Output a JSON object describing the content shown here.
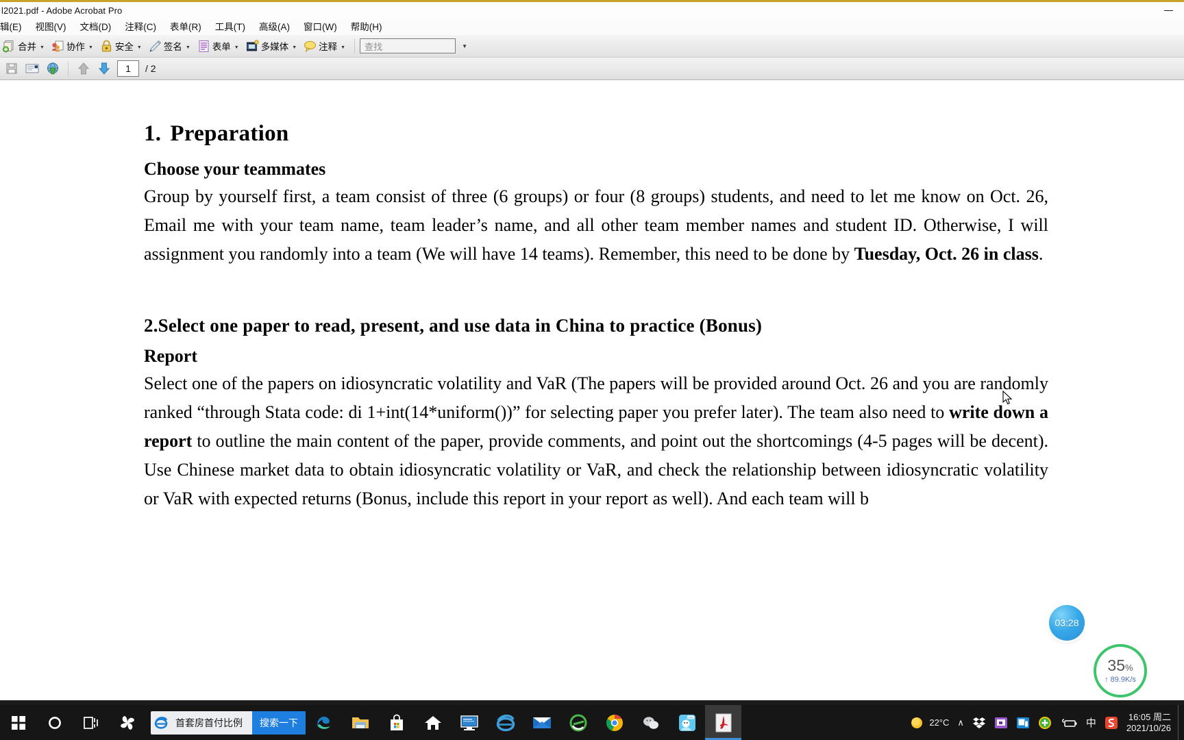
{
  "window": {
    "title": "l2021.pdf - Adobe Acrobat Pro",
    "minimize_label": "—"
  },
  "menubar": {
    "items": [
      {
        "label": "辑(E)",
        "name": "menu-edit"
      },
      {
        "label": "视图(V)",
        "name": "menu-view"
      },
      {
        "label": "文档(D)",
        "name": "menu-document"
      },
      {
        "label": "注释(C)",
        "name": "menu-comments"
      },
      {
        "label": "表单(R)",
        "name": "menu-forms"
      },
      {
        "label": "工具(T)",
        "name": "menu-tools"
      },
      {
        "label": "高级(A)",
        "name": "menu-advanced"
      },
      {
        "label": "窗口(W)",
        "name": "menu-window"
      },
      {
        "label": "帮助(H)",
        "name": "menu-help"
      }
    ]
  },
  "toolbar": {
    "buttons": [
      {
        "label": "合并",
        "icon": "merge-icon",
        "name": "toolbar-merge"
      },
      {
        "label": "协作",
        "icon": "collaborate-icon",
        "name": "toolbar-collaborate"
      },
      {
        "label": "安全",
        "icon": "lock-icon",
        "name": "toolbar-security"
      },
      {
        "label": "签名",
        "icon": "pen-icon",
        "name": "toolbar-sign"
      },
      {
        "label": "表单",
        "icon": "form-icon",
        "name": "toolbar-forms"
      },
      {
        "label": "多媒体",
        "icon": "multimedia-icon",
        "name": "toolbar-multimedia"
      },
      {
        "label": "注释",
        "icon": "comment-icon",
        "name": "toolbar-comment"
      }
    ],
    "find_placeholder": "查找"
  },
  "navbar": {
    "page_value": "1",
    "page_total": "/ 2"
  },
  "document": {
    "section1": {
      "number": "1.",
      "title": "Preparation",
      "subheading": "Choose your teammates",
      "paragraph_pre": "Group by yourself first, a team consist of three (6 groups) or four (8 groups) students, and need to let me know on Oct. 26, Email me with your team name, team leader’s name, and all other team member names and student ID. Otherwise, I will assignment you randomly into a team (We will have 14 teams). Remember, this need to be done by ",
      "paragraph_bold": "Tuesday, Oct. 26 in class",
      "paragraph_post": "."
    },
    "section2": {
      "title": "2.Select one paper to read, present, and use data in China to practice (Bonus)",
      "subheading": "Report",
      "paragraph_pre": "Select one of the papers on idiosyncratic volatility and VaR (The papers will be provided around Oct. 26 and you are randomly ranked “through Stata code: di 1+int(14*uniform())” for selecting paper you prefer later). The team also need to ",
      "paragraph_bold1": "write down a report",
      "paragraph_mid": " to outline the main content of the paper, provide comments, and point out the shortcomings (4-5 pages will be decent). Use Chinese market data to obtain idiosyncratic volatility or VaR, and check the relationship between idiosyncratic volatility or VaR with expected returns (Bonus, include this report in your report as well). And each team will b"
    }
  },
  "widgets": {
    "timer": "03:28",
    "netspeed_percent": "35",
    "netspeed_unit": "%",
    "netspeed_rate": "↑ 89.9K/s"
  },
  "taskbar": {
    "search_keyword": "首套房首付比例",
    "search_button": "搜索一下",
    "apps": [
      {
        "name": "taskbar-cortana-icon",
        "icon": "circle"
      },
      {
        "name": "taskbar-taskview-icon",
        "icon": "taskview"
      },
      {
        "name": "taskbar-sogou-icon",
        "icon": "sogou-pinwheel"
      }
    ],
    "pinned": [
      {
        "name": "taskbar-edge-icon",
        "icon": "edge"
      },
      {
        "name": "taskbar-explorer-icon",
        "icon": "folder"
      },
      {
        "name": "taskbar-store-icon",
        "icon": "store"
      },
      {
        "name": "taskbar-home-icon",
        "icon": "home"
      },
      {
        "name": "taskbar-monitor-icon",
        "icon": "monitor"
      },
      {
        "name": "taskbar-ie-icon",
        "icon": "ie"
      },
      {
        "name": "taskbar-mail-icon",
        "icon": "mail"
      },
      {
        "name": "taskbar-360browser-icon",
        "icon": "green-e"
      },
      {
        "name": "taskbar-chrome-icon",
        "icon": "chrome"
      },
      {
        "name": "taskbar-wechat-icon",
        "icon": "gray-app"
      },
      {
        "name": "taskbar-live-icon",
        "icon": "live-app"
      },
      {
        "name": "taskbar-acrobat-icon",
        "icon": "acrobat"
      }
    ],
    "tray": {
      "weather_temp": "22°C",
      "chevron": "∧",
      "ime_label": "中",
      "time": "16:05 周二",
      "date": "2021/10/26"
    }
  }
}
